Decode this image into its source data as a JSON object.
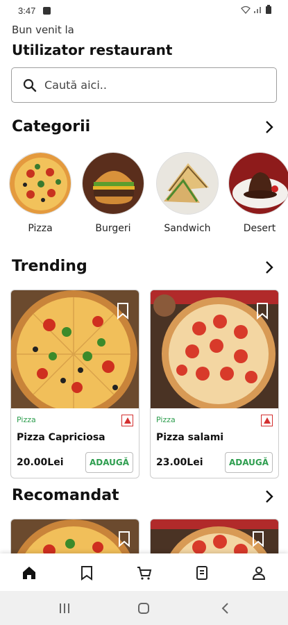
{
  "status": {
    "time": "3:47"
  },
  "header": {
    "welcome": "Bun venit la",
    "user_name": "Utilizator restaurant"
  },
  "search": {
    "placeholder": "Caută aici.."
  },
  "categories": {
    "title": "Categorii",
    "items": [
      {
        "label": "Pizza"
      },
      {
        "label": "Burgeri"
      },
      {
        "label": "Sandwich"
      },
      {
        "label": "Desert"
      }
    ]
  },
  "trending": {
    "title": "Trending",
    "items": [
      {
        "category": "Pizza",
        "name": "Pizza Capriciosa",
        "price": "20.00Lei",
        "add_label": "ADAUGĂ"
      },
      {
        "category": "Pizza",
        "name": "Pizza salami",
        "price": "23.00Lei",
        "add_label": "ADAUGĂ"
      }
    ]
  },
  "recommended": {
    "title": "Recomandat"
  },
  "bottom_nav": [
    "home-icon",
    "bookmark-icon",
    "cart-icon",
    "orders-icon",
    "profile-icon"
  ],
  "colors": {
    "accent_green": "#2e9e4f",
    "nonveg_red": "#d32f2f"
  }
}
